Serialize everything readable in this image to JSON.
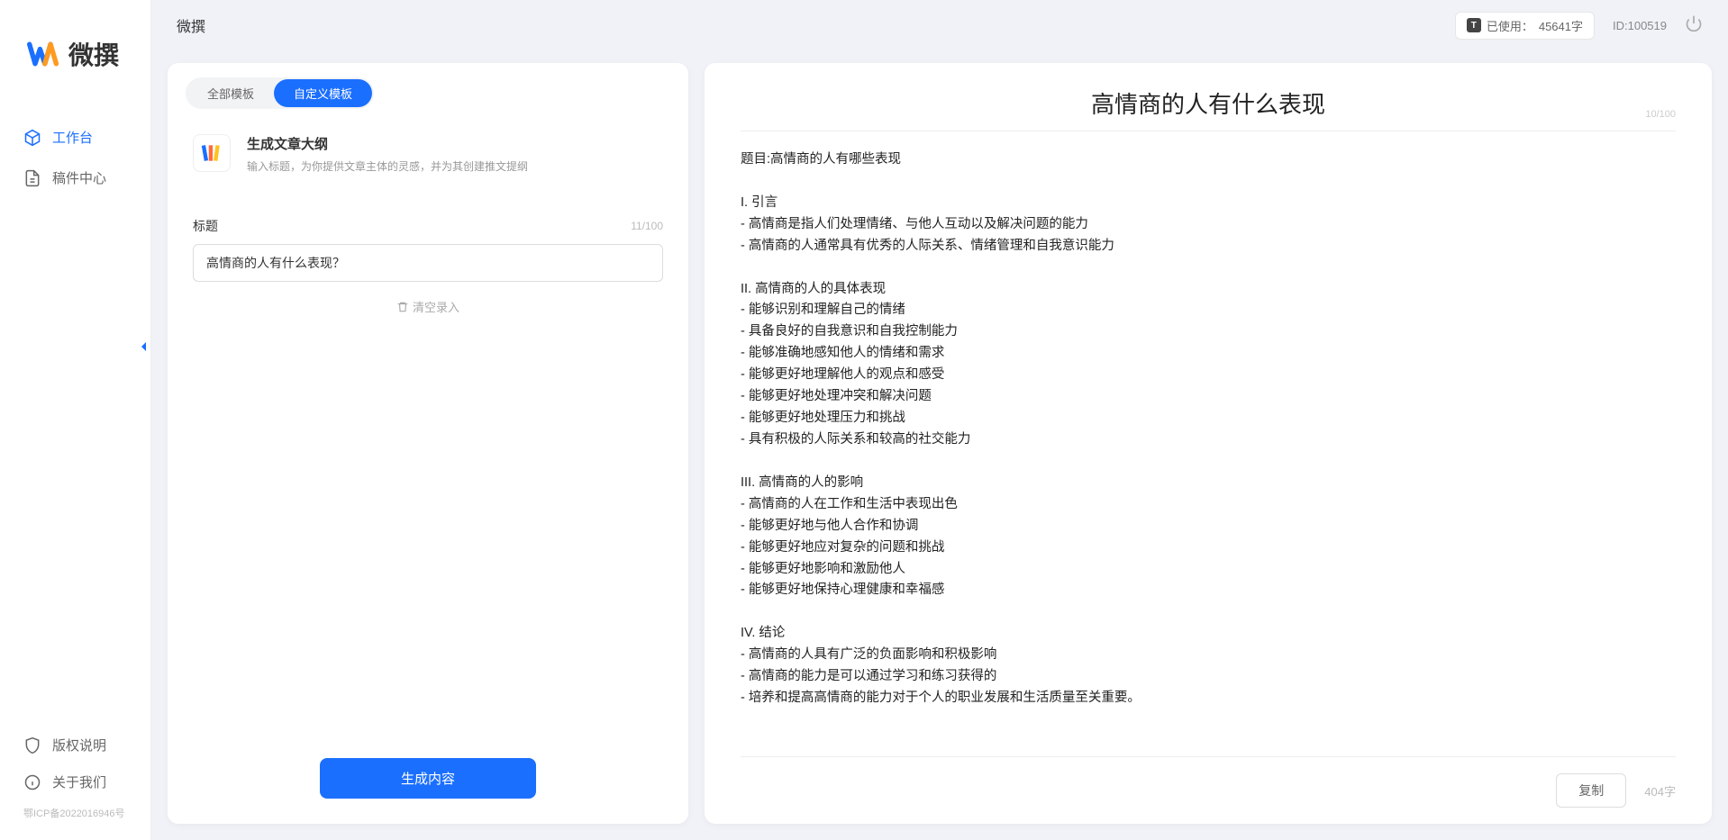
{
  "app": {
    "logo_text": "微撰",
    "page_title": "微撰"
  },
  "sidebar": {
    "items": [
      {
        "label": "工作台",
        "active": true
      },
      {
        "label": "稿件中心",
        "active": false
      }
    ],
    "bottom": [
      {
        "label": "版权说明"
      },
      {
        "label": "关于我们"
      }
    ],
    "icp": "鄂ICP备2022016946号"
  },
  "topbar": {
    "usage_label": "已使用：",
    "usage_value": "45641字",
    "id_label": "ID:100519"
  },
  "left_panel": {
    "tabs": [
      {
        "label": "全部模板",
        "active": false
      },
      {
        "label": "自定义模板",
        "active": true
      }
    ],
    "template": {
      "title": "生成文章大纲",
      "desc": "输入标题，为你提供文章主体的灵感，并为其创建推文提纲"
    },
    "form": {
      "label": "标题",
      "char_counter": "11/100",
      "input_value": "高情商的人有什么表现？",
      "clear_label": "清空录入"
    },
    "generate_label": "生成内容"
  },
  "right_panel": {
    "heading": "高情商的人有什么表现",
    "heading_counter": "10/100",
    "body": "题目:高情商的人有哪些表现\n\nI. 引言\n- 高情商是指人们处理情绪、与他人互动以及解决问题的能力\n- 高情商的人通常具有优秀的人际关系、情绪管理和自我意识能力\n\nII. 高情商的人的具体表现\n- 能够识别和理解自己的情绪\n- 具备良好的自我意识和自我控制能力\n- 能够准确地感知他人的情绪和需求\n- 能够更好地理解他人的观点和感受\n- 能够更好地处理冲突和解决问题\n- 能够更好地处理压力和挑战\n- 具有积极的人际关系和较高的社交能力\n\nIII. 高情商的人的影响\n- 高情商的人在工作和生活中表现出色\n- 能够更好地与他人合作和协调\n- 能够更好地应对复杂的问题和挑战\n- 能够更好地影响和激励他人\n- 能够更好地保持心理健康和幸福感\n\nIV. 结论\n- 高情商的人具有广泛的负面影响和积极影响\n- 高情商的能力是可以通过学习和练习获得的\n- 培养和提高高情商的能力对于个人的职业发展和生活质量至关重要。",
    "copy_label": "复制",
    "word_count": "404字"
  }
}
